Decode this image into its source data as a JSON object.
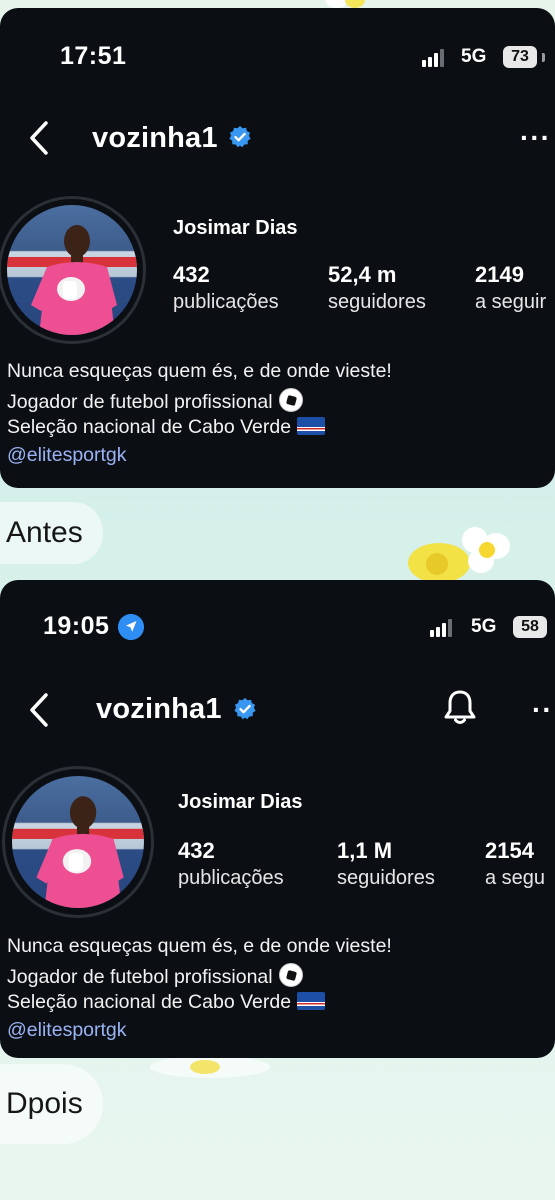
{
  "before": {
    "status": {
      "time": "17:51",
      "network": "5G",
      "battery": "73"
    },
    "header": {
      "username": "vozinha1"
    },
    "profile": {
      "full_name": "Josimar Dias",
      "stats": [
        {
          "value": "432",
          "label": "publicações"
        },
        {
          "value": "52,4 m",
          "label": "seguidores"
        },
        {
          "value": "2149",
          "label": "a seguir"
        }
      ],
      "bio": [
        "Nunca esqueças quem és, e de onde vieste!",
        "Jogador de futebol profissional",
        "Seleção nacional de Cabo Verde"
      ],
      "link": "@elitesportgk"
    },
    "caption": "Antes"
  },
  "after": {
    "status": {
      "time": "19:05",
      "network": "5G",
      "battery": "58"
    },
    "header": {
      "username": "vozinha1"
    },
    "profile": {
      "full_name": "Josimar Dias",
      "stats": [
        {
          "value": "432",
          "label": "publicações"
        },
        {
          "value": "1,1 M",
          "label": "seguidores"
        },
        {
          "value": "2154",
          "label": "a segu"
        }
      ],
      "bio": [
        "Nunca esqueças quem és, e de onde vieste!",
        "Jogador de futebol profissional",
        "Seleção nacional de Cabo Verde"
      ],
      "link": "@elitesportgk"
    },
    "caption": "Dpois"
  },
  "icons": {
    "verified": "verified-badge-icon",
    "back": "chevron-left-icon",
    "more": "more-dots-icon",
    "bell": "bell-icon",
    "location": "location-arrow-icon",
    "soccer": "soccer-ball-icon",
    "flag": "cape-verde-flag-icon"
  },
  "colors": {
    "panel_bg": "#0b0f14",
    "verified_blue": "#3897f0",
    "link": "#9bb3f5"
  }
}
